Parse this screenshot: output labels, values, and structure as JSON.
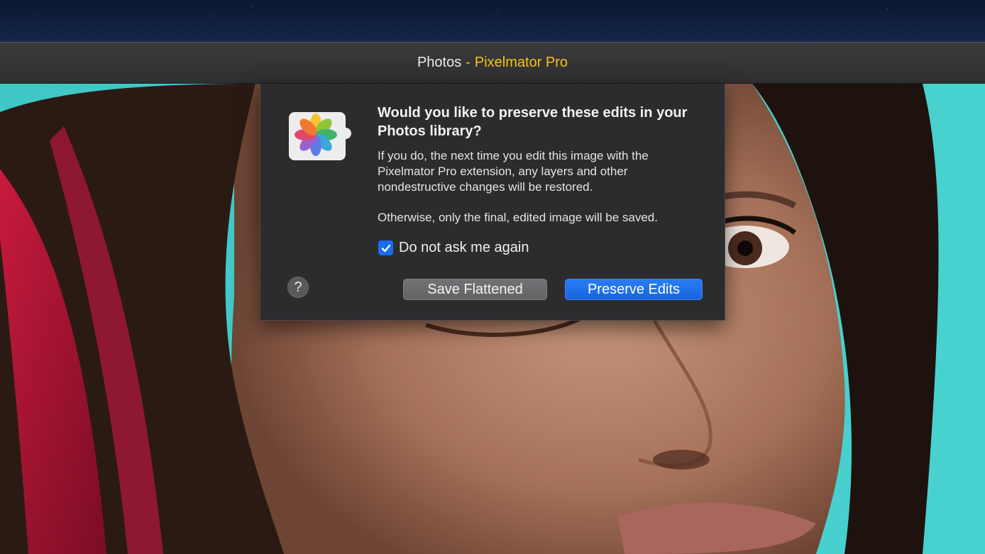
{
  "window": {
    "title_source": "Photos",
    "title_separator": "-",
    "title_app": "Pixelmator Pro"
  },
  "dialog": {
    "icon": "photos-extension-icon",
    "title": "Would you like to preserve these edits in your Photos library?",
    "body": "If you do, the next time you edit this image with the Pixelmator Pro extension, any layers and other nondestructive changes will be restored.",
    "body_secondary": "Otherwise, only the final, edited image will be saved.",
    "checkbox_label": "Do not ask me again",
    "checkbox_checked": true,
    "help_label": "?",
    "secondary_button": "Save Flattened",
    "primary_button": "Preserve Edits"
  },
  "colors": {
    "accent": "#1a6cf0",
    "title_app": "#f5c518",
    "dialog_bg": "#2c2c2e"
  }
}
